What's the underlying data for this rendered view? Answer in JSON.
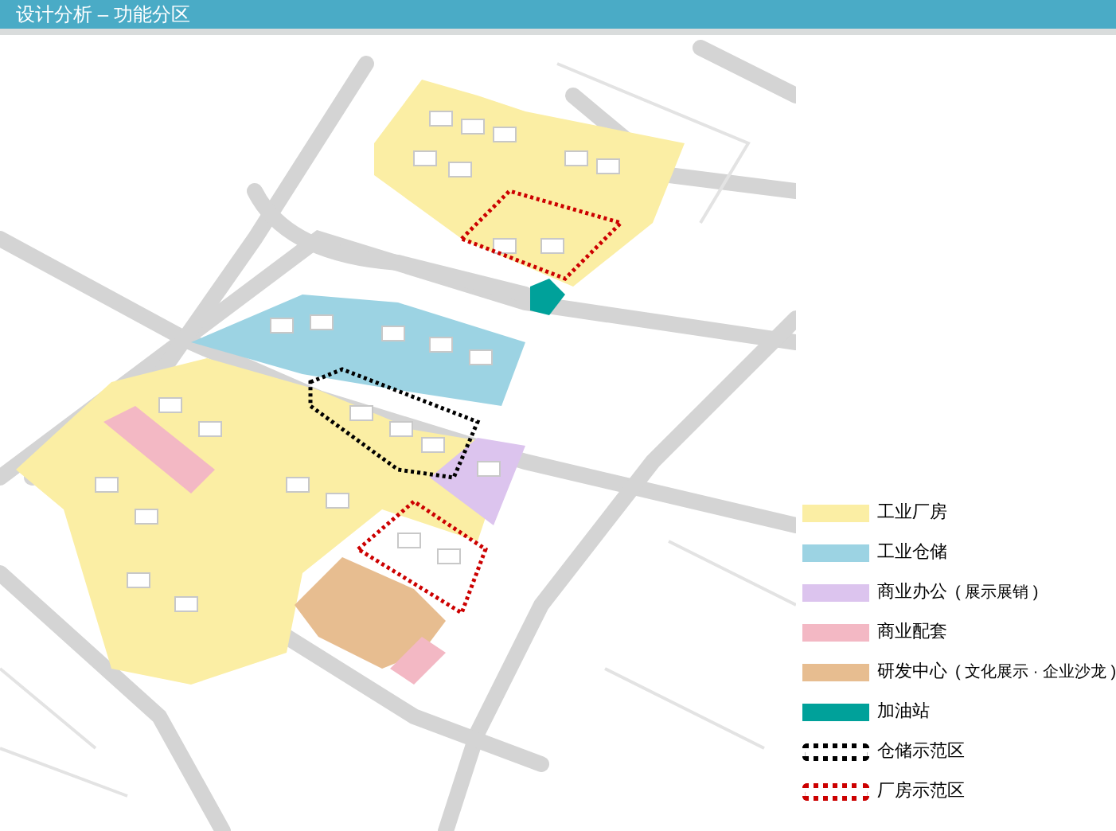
{
  "header": {
    "title": "设计分析 – 功能分区"
  },
  "legend": [
    {
      "kind": "swatch",
      "color": "#fbeea4",
      "label": "工业厂房"
    },
    {
      "kind": "swatch",
      "color": "#9cd3e3",
      "label": "工业仓储"
    },
    {
      "kind": "swatch",
      "color": "#dcc4ee",
      "label": "商业办公",
      "note": "( 展示展销 )"
    },
    {
      "kind": "swatch",
      "color": "#f3b8c4",
      "label": "商业配套"
    },
    {
      "kind": "swatch",
      "color": "#e7bd90",
      "label": "研发中心",
      "note": "( 文化展示 · 企业沙龙 )"
    },
    {
      "kind": "swatch",
      "color": "#00a19a",
      "label": "加油站"
    },
    {
      "kind": "outline",
      "color": "#000000",
      "label": "仓储示范区"
    },
    {
      "kind": "outline",
      "color": "#cc0000",
      "label": "厂房示范区"
    }
  ]
}
